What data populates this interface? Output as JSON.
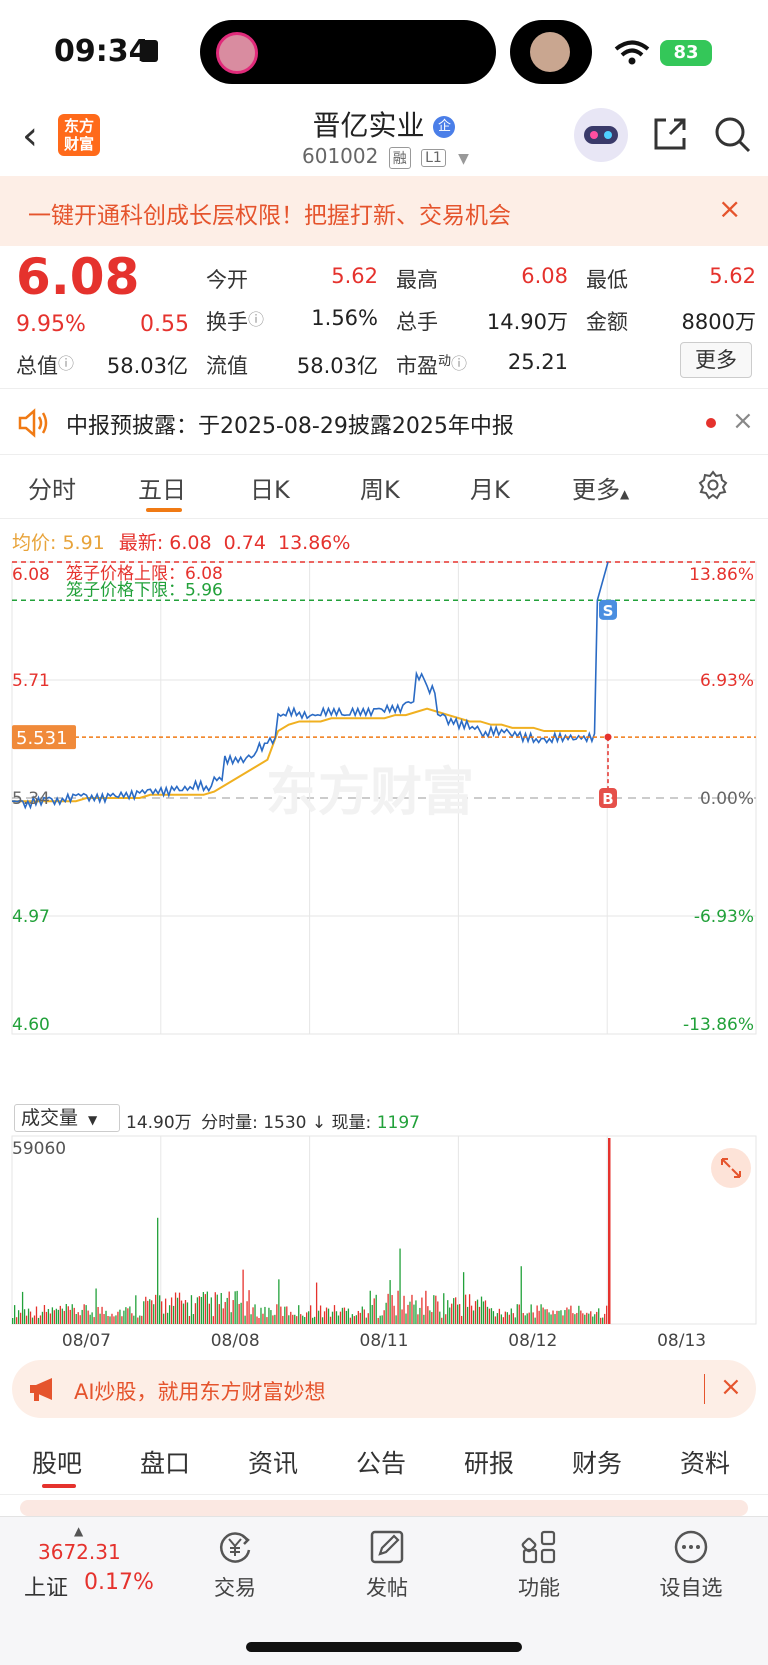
{
  "status": {
    "time": "09:34",
    "battery": "83"
  },
  "header": {
    "logo": "东方\n财富",
    "name": "晋亿实业",
    "name_badge": "企",
    "code": "601002",
    "tags": [
      "融",
      "L1"
    ]
  },
  "promo": {
    "text": "一键开通科创成长层权限！把握打新、交易机会",
    "close": "×"
  },
  "quote": {
    "price": "6.08",
    "pct": "9.95%",
    "chg": "0.55",
    "fields": [
      {
        "label": "今开",
        "value": "5.62",
        "color": "red"
      },
      {
        "label": "最高",
        "value": "6.08",
        "color": "red"
      },
      {
        "label": "最低",
        "value": "5.62",
        "color": "red"
      },
      {
        "label": "换手",
        "value": "1.56%",
        "color": "dark"
      },
      {
        "label": "总手",
        "value": "14.90万",
        "color": "dark"
      },
      {
        "label": "金额",
        "value": "8800万",
        "color": "dark"
      },
      {
        "label": "总值",
        "value": "58.03亿",
        "color": "dark"
      },
      {
        "label": "流值",
        "value": "58.03亿",
        "color": "dark"
      },
      {
        "label": "市盈",
        "sup": "动",
        "value": "25.21",
        "color": "dark"
      }
    ],
    "more": "更多"
  },
  "notice": {
    "text": "中报预披露：于2025-08-29披露2025年中报",
    "close": "×"
  },
  "chart_tabs": [
    "分时",
    "五日",
    "日K",
    "周K",
    "月K",
    "更多"
  ],
  "active_tab": 1,
  "info_line": {
    "avg_label": "均价:",
    "avg": "5.91",
    "last_label": "最新:",
    "last": "6.08",
    "chg": "0.74",
    "pct": "13.86%"
  },
  "chart_data": {
    "type": "line",
    "y_left_ticks": [
      "6.08",
      "5.71",
      "5.34",
      "4.97",
      "4.60"
    ],
    "y_right_ticks": [
      "13.86%",
      "6.93%",
      "0.00%",
      "-6.93%",
      "-13.86%"
    ],
    "ylim": [
      4.6,
      6.08
    ],
    "x_labels": [
      "08/07",
      "08/08",
      "08/11",
      "08/12",
      "08/13"
    ],
    "cage_upper": {
      "label": "笼子价格上限：6.08",
      "value": 6.08
    },
    "cage_lower": {
      "label": "笼子价格下限：5.96",
      "value": 5.96
    },
    "cursor_price": "5.531",
    "markers": {
      "sell": "S",
      "buy": "B"
    },
    "watermark": "东方财富",
    "series": [
      {
        "values": [
          5.33,
          5.32,
          5.33,
          5.34,
          5.33,
          5.34,
          5.35,
          5.34,
          5.34,
          5.35,
          5.35,
          5.35,
          5.36,
          5.36,
          5.36,
          5.37,
          5.37,
          5.38,
          5.37,
          5.4,
          5.46,
          5.46,
          5.47,
          5.5,
          5.52,
          5.6,
          5.61,
          5.6,
          5.6,
          5.61,
          5.61,
          5.6,
          5.61,
          5.61,
          5.62,
          5.62,
          5.62,
          5.64,
          5.72,
          5.68,
          5.6,
          5.58,
          5.57,
          5.56,
          5.54,
          5.55,
          5.55,
          5.54,
          5.53,
          5.52,
          5.52,
          5.53,
          5.53,
          5.53,
          5.53,
          5.96,
          6.08
        ]
      },
      {
        "values": [
          5.33,
          5.33,
          5.33,
          5.33,
          5.33,
          5.33,
          5.33,
          5.34,
          5.34,
          5.34,
          5.34,
          5.34,
          5.34,
          5.35,
          5.35,
          5.35,
          5.35,
          5.35,
          5.35,
          5.36,
          5.38,
          5.4,
          5.42,
          5.44,
          5.46,
          5.55,
          5.57,
          5.58,
          5.58,
          5.58,
          5.59,
          5.59,
          5.59,
          5.59,
          5.59,
          5.59,
          5.6,
          5.6,
          5.61,
          5.62,
          5.61,
          5.6,
          5.59,
          5.58,
          5.58,
          5.57,
          5.57,
          5.56,
          5.56,
          5.56,
          5.55,
          5.55,
          5.55,
          5.55,
          5.55
        ]
      }
    ]
  },
  "volume": {
    "selector": "成交量",
    "total": "14.90万",
    "per_label": "分时量:",
    "per": "1530",
    "now_label": "现量:",
    "now": "1197",
    "max_tick": "59060"
  },
  "ai_banner": {
    "text": "AI炒股，就用东方财富妙想",
    "close": "×"
  },
  "bottom_tabs": [
    "股吧",
    "盘口",
    "资讯",
    "公告",
    "研报",
    "财务",
    "资料"
  ],
  "nav": {
    "index_value": "3672.31",
    "index_name": "上证",
    "index_pct": "0.17%",
    "items": [
      "交易",
      "发帖",
      "功能",
      "设自选"
    ]
  }
}
